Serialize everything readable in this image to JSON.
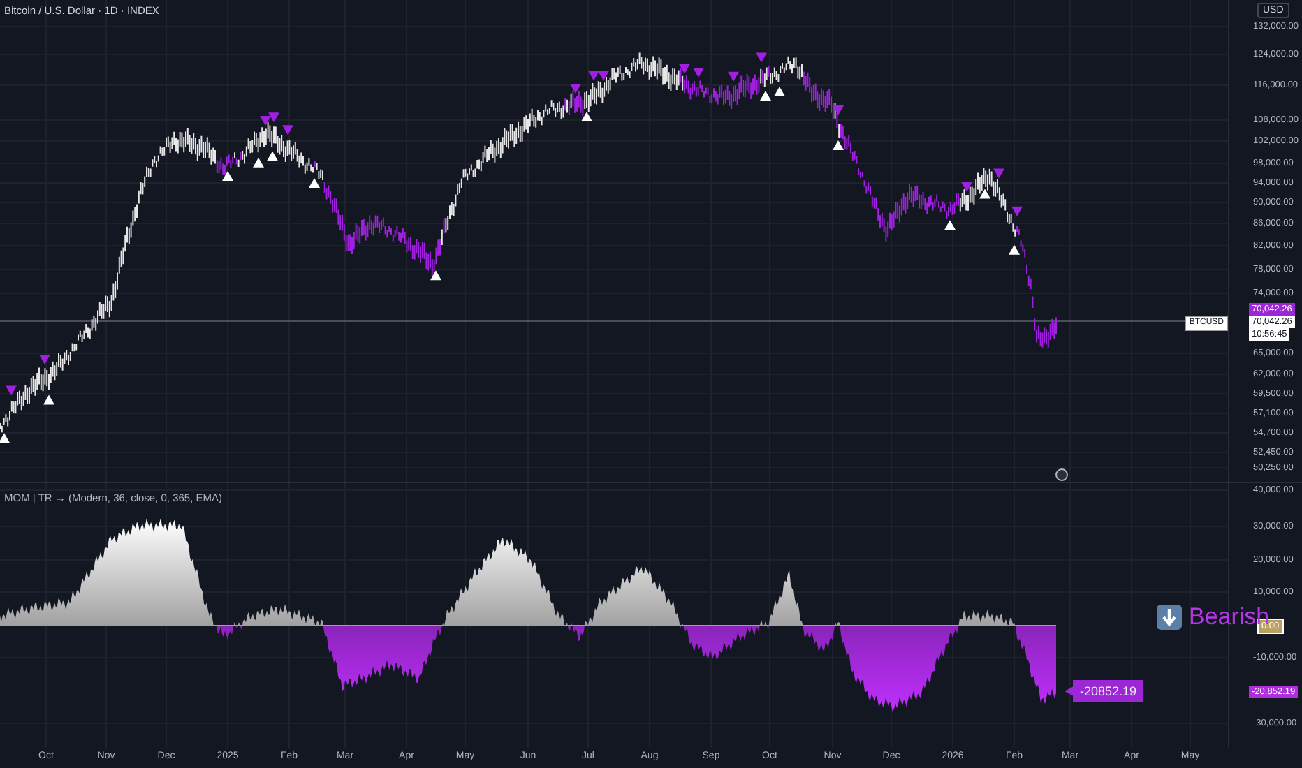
{
  "header": {
    "title": "Bitcoin / U.S. Dollar · 1D · INDEX"
  },
  "price_axis": {
    "currency": "USD",
    "ticks": [
      "132,000.00",
      "124,000.00",
      "116,000.00",
      "108,000.00",
      "102,000.00",
      "98,000.00",
      "94,000.00",
      "90,000.00",
      "86,000.00",
      "82,000.00",
      "78,000.00",
      "74,000.00",
      "65,000.00",
      "62,000.00",
      "59,500.00",
      "57,100.00",
      "54,700.00",
      "52,450.00",
      "50,250.00"
    ]
  },
  "last_price": {
    "value": "70,042.26",
    "symbol": "BTCUSD",
    "price": "70,042.26",
    "countdown": "10:56:45"
  },
  "indicator": {
    "legend": "MOM | TR → (Modern, 36, close, 0, 365, EMA)",
    "axis_ticks": [
      "40,000.00",
      "30,000.00",
      "20,000.00",
      "10,000.00",
      "-10,000.00",
      "-30,000.00"
    ],
    "zero_label": "0.00",
    "value_label": "-20,852.19",
    "tooltip": "-20852.19",
    "signal": {
      "kind": "bearish",
      "label": "Bearish"
    }
  },
  "time_axis": [
    "Oct",
    "Nov",
    "Dec",
    "2025",
    "Feb",
    "Mar",
    "Apr",
    "May",
    "Jun",
    "Jul",
    "Aug",
    "Sep",
    "Oct",
    "Nov",
    "Dec",
    "2026",
    "Feb",
    "Mar",
    "Apr",
    "May"
  ]
}
